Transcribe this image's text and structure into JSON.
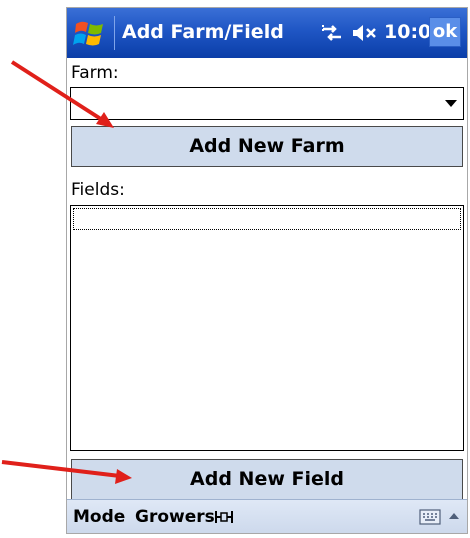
{
  "titlebar": {
    "title": "Add Farm/Field",
    "time": "10:02",
    "ok_label": "ok",
    "icons": [
      "windows-start-icon",
      "connectivity-icon",
      "volume-muted-icon"
    ]
  },
  "farm": {
    "label": "Farm:",
    "selected_value": "",
    "add_button_label": "Add New Farm"
  },
  "fields": {
    "label": "Fields:",
    "items": [],
    "add_button_label": "Add New Field"
  },
  "menubar": {
    "mode_label": "Mode",
    "growers_label": "Growers",
    "icons": [
      "network-tool-icon",
      "keyboard-icon",
      "sip-up-arrow-icon"
    ]
  },
  "colors": {
    "titlebar": "#1f56c4",
    "button_face": "#cfdbec",
    "annotation_arrow": "#e0201a"
  }
}
